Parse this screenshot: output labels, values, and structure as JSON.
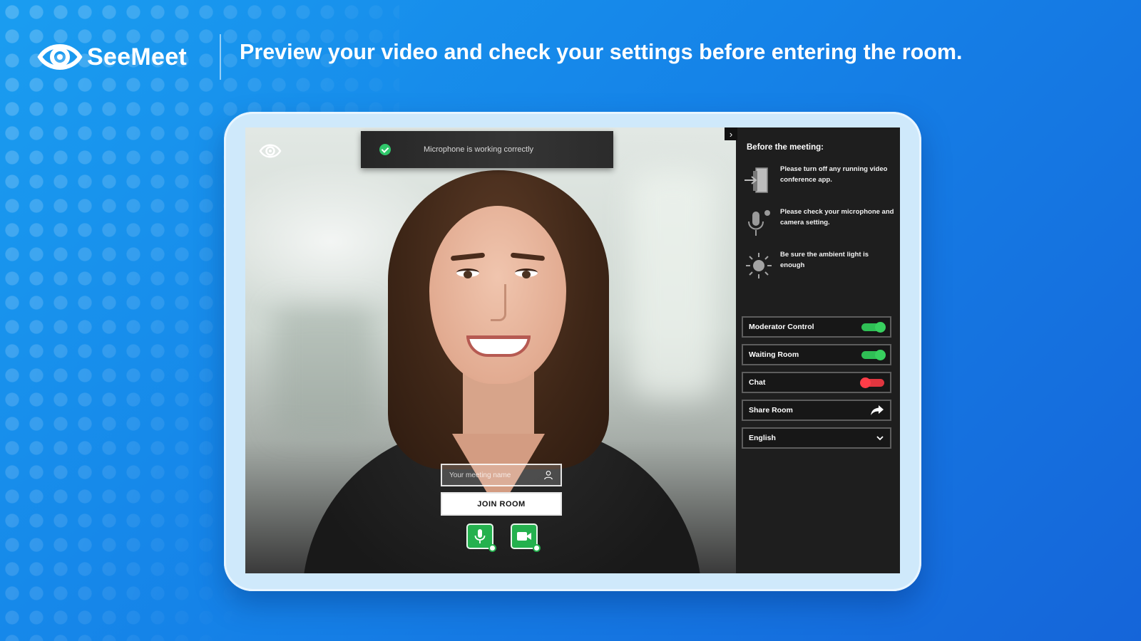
{
  "brand": {
    "name": "SeeMeet"
  },
  "header": {
    "tagline": "Preview your video and check your settings before entering the room."
  },
  "video": {
    "mic_status": "Microphone is working correctly",
    "name_placeholder": "Your meeting name",
    "join_label": "JOIN ROOM"
  },
  "panel": {
    "title": "Before the meeting:",
    "tips": [
      {
        "icon": "exit-icon",
        "text": "Please turn off any running video conference app."
      },
      {
        "icon": "microphone-icon",
        "text": "Please check your microphone and camera setting."
      },
      {
        "icon": "sun-icon",
        "text": "Be sure the ambient light is enough"
      }
    ],
    "controls": [
      {
        "label": "Moderator Control",
        "state": "on"
      },
      {
        "label": "Waiting Room",
        "state": "on"
      },
      {
        "label": "Chat",
        "state": "off"
      },
      {
        "label": "Share Room",
        "icon": "share-icon"
      }
    ],
    "language": "English"
  },
  "colors": {
    "toggle_on": "#2fbf55",
    "toggle_off": "#e0363f",
    "media_button": "#24b14e",
    "background": "#1583e8"
  }
}
